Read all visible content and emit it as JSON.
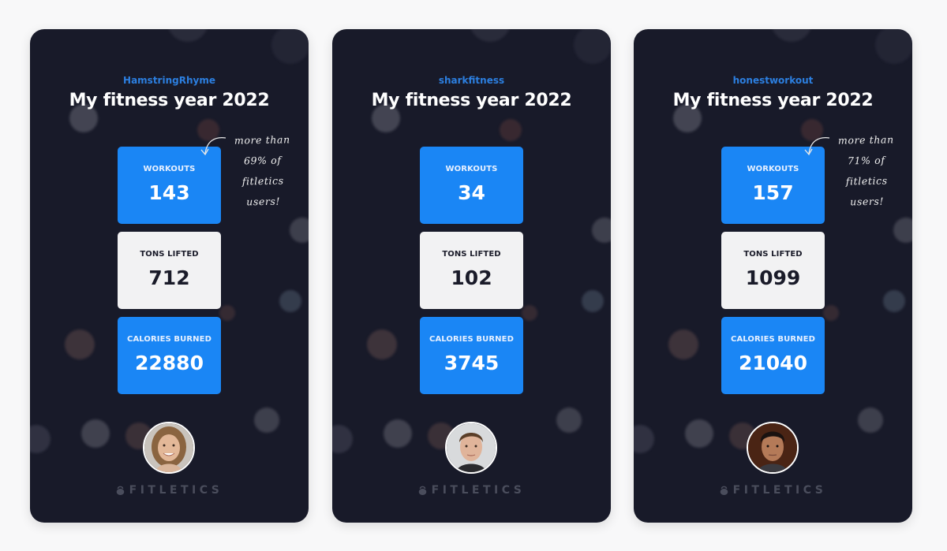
{
  "colors": {
    "page_background": "#f8f8f9",
    "card_background": "#181a29",
    "accent_blue": "#1a86f5",
    "username_blue": "#2c7fe0",
    "light_tile": "#f2f2f3",
    "dark_text": "#1a1b29",
    "brand_gray": "#4a4d5c"
  },
  "cards": [
    {
      "username": "HamstringRhyme",
      "title": "My fitness year 2022",
      "stats": [
        {
          "label": "WORKOUTS",
          "value": "143",
          "style": "blue"
        },
        {
          "label": "TONS LIFTED",
          "value": "712",
          "style": "light"
        },
        {
          "label": "CALORIES BURNED",
          "value": "22880",
          "style": "blue"
        }
      ],
      "note": {
        "lines": [
          "more than",
          "69% of",
          "fitletics",
          "users!"
        ]
      },
      "avatar": {
        "description": "smiling woman with light brown hair",
        "icon": "user-photo"
      },
      "brand": {
        "name": "FITLETICS",
        "icon": "kettlebell-icon"
      }
    },
    {
      "username": "sharkfitness",
      "title": "My fitness year 2022",
      "stats": [
        {
          "label": "WORKOUTS",
          "value": "34",
          "style": "blue"
        },
        {
          "label": "TONS LIFTED",
          "value": "102",
          "style": "light"
        },
        {
          "label": "CALORIES BURNED",
          "value": "3745",
          "style": "blue"
        }
      ],
      "note": null,
      "avatar": {
        "description": "young man with short brown hair",
        "icon": "user-photo"
      },
      "brand": {
        "name": "FITLETICS",
        "icon": "kettlebell-icon"
      }
    },
    {
      "username": "honestworkout",
      "title": "My fitness year 2022",
      "stats": [
        {
          "label": "WORKOUTS",
          "value": "157",
          "style": "blue"
        },
        {
          "label": "TONS LIFTED",
          "value": "1099",
          "style": "light"
        },
        {
          "label": "CALORIES BURNED",
          "value": "21040",
          "style": "blue"
        }
      ],
      "note": {
        "lines": [
          "more than",
          "71% of",
          "fitletics",
          "users!"
        ]
      },
      "avatar": {
        "description": "man with dark hair",
        "icon": "user-photo"
      },
      "brand": {
        "name": "FITLETICS",
        "icon": "kettlebell-icon"
      }
    }
  ]
}
